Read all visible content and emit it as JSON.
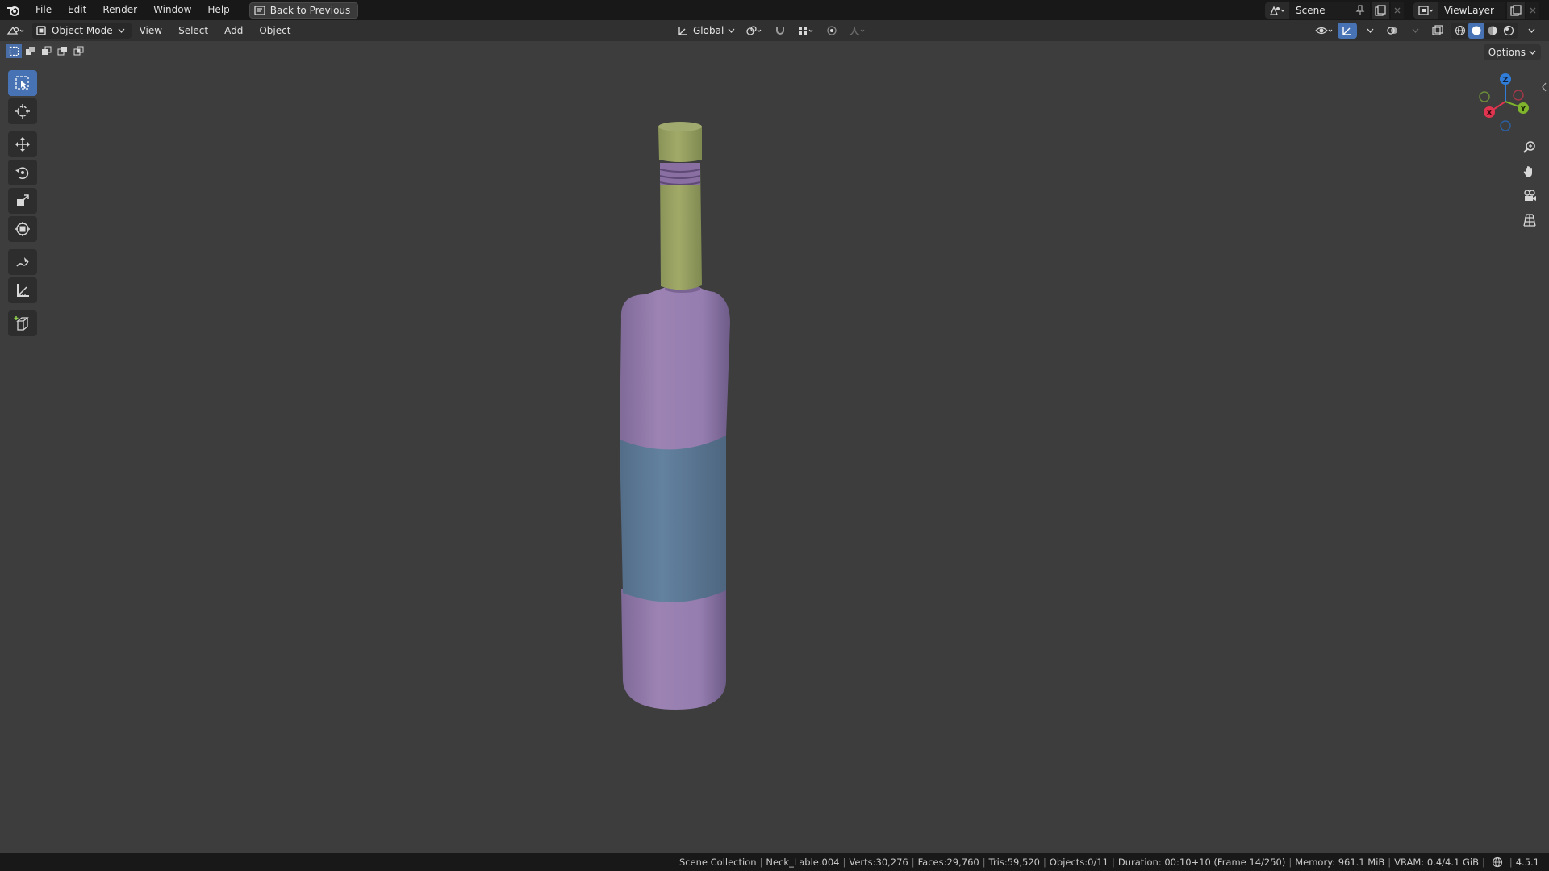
{
  "menu": {
    "items": [
      "File",
      "Edit",
      "Render",
      "Window",
      "Help"
    ],
    "back_button": "Back to Previous"
  },
  "scene": {
    "name": "Scene"
  },
  "view_layer": {
    "name": "ViewLayer"
  },
  "header": {
    "mode": "Object Mode",
    "menus": [
      "View",
      "Select",
      "Add",
      "Object"
    ],
    "orientation": "Global",
    "options_label": "Options"
  },
  "toolbar": {
    "tools": [
      "select-box",
      "cursor",
      "move",
      "rotate",
      "scale",
      "transform",
      "annotate",
      "measure",
      "add-cube"
    ],
    "active_tool": "select-box"
  },
  "navigation": {
    "axes": [
      "X",
      "Y",
      "Z"
    ],
    "buttons": [
      "zoom",
      "pan",
      "camera",
      "perspective-toggle"
    ]
  },
  "viewport": {
    "background": "#3d3d3d",
    "object_colors": {
      "cap": "#8a9b5e",
      "neck": "#9aa464",
      "body": "#9a7fb2",
      "label": "#5e7b98"
    }
  },
  "status": {
    "collection": "Scene Collection",
    "active_object": "Neck_Lable.004",
    "verts": "Verts:30,276",
    "faces": "Faces:29,760",
    "tris": "Tris:59,520",
    "objects": "Objects:0/11",
    "duration": "Duration: 00:10+10 (Frame 14/250)",
    "memory": "Memory: 961.1 MiB",
    "vram": "VRAM: 0.4/4.1 GiB",
    "version": "4.5.1"
  }
}
